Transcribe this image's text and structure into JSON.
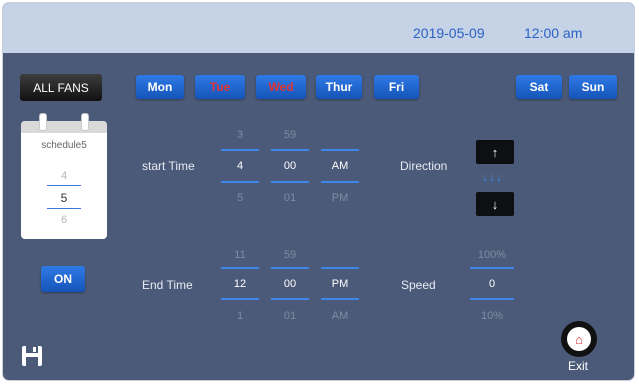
{
  "header": {
    "date": "2019-05-09",
    "time": "12:00 am"
  },
  "group": {
    "label": "ALL FANS"
  },
  "days": [
    {
      "label": "Mon",
      "active": true
    },
    {
      "label": "Tue",
      "active": false
    },
    {
      "label": "Wed",
      "active": false
    },
    {
      "label": "Thur",
      "active": true
    },
    {
      "label": "Fri",
      "active": true
    },
    {
      "label": "Sat",
      "active": true
    },
    {
      "label": "Sun",
      "active": true
    }
  ],
  "schedule": {
    "name": "schedule5",
    "prev": "4",
    "current": "5",
    "next": "6"
  },
  "toggle": {
    "label": "ON"
  },
  "start": {
    "label": "start Time",
    "hour": {
      "prev": "3",
      "current": "4",
      "next": "5"
    },
    "minute": {
      "prev": "59",
      "current": "00",
      "next": "01"
    },
    "ampm": {
      "current": "AM",
      "next": "PM"
    }
  },
  "end": {
    "label": "End Time",
    "hour": {
      "prev": "11",
      "current": "12",
      "next": "1"
    },
    "minute": {
      "prev": "59",
      "current": "00",
      "next": "01"
    },
    "ampm": {
      "current": "PM",
      "next": "AM"
    }
  },
  "direction": {
    "label": "Direction",
    "up_icon": "arrow-up",
    "down_icon": "arrow-down",
    "flow": "↓↓↓"
  },
  "speed": {
    "label": "Speed",
    "prev": "100%",
    "current": "0",
    "next": "10%"
  },
  "exit": {
    "label": "Exit"
  },
  "colors": {
    "accent": "#2f7ae6",
    "inactive_day_text": "#e03535",
    "panel": "#4b5a78",
    "header": "#c6d2e6"
  }
}
